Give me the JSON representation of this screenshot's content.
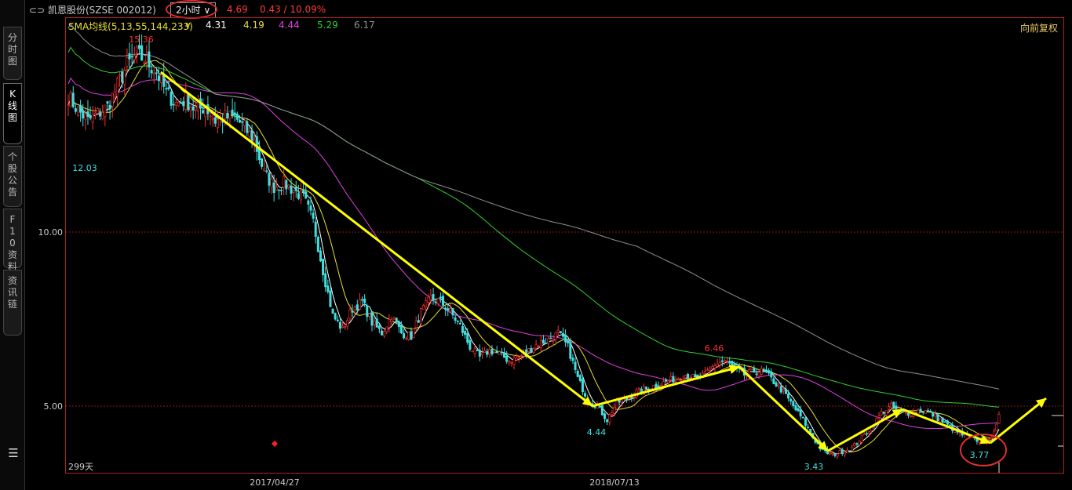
{
  "sidebar": {
    "tabs": [
      {
        "label": "分时图",
        "active": false
      },
      {
        "label": "K线图",
        "active": true
      },
      {
        "label": "个股公告",
        "active": false
      },
      {
        "label": "F10资料",
        "active": false
      },
      {
        "label": "资讯链",
        "active": false
      }
    ],
    "menu_icon": "menu-icon"
  },
  "header": {
    "stock": "凯恩股份(SZSE 002012)",
    "period": "2小时",
    "price": "4.69",
    "change": "0.43 / 10.09%"
  },
  "sma": {
    "label": "SMA均线(5,13,55,144,233)",
    "values": [
      {
        "value": "4.31",
        "color": "#ffffff"
      },
      {
        "value": "4.19",
        "color": "#e8e030"
      },
      {
        "value": "4.44",
        "color": "#e040e0"
      },
      {
        "value": "5.29",
        "color": "#30d030"
      },
      {
        "value": "6.17",
        "color": "#909090"
      }
    ]
  },
  "fq_label": "向前复权",
  "colors": {
    "up": "#ff3030",
    "down": "#40e0e0",
    "frame": "#b02020",
    "arrow": "#ffff00",
    "circle": "#e03030"
  },
  "chart_data": {
    "type": "candlestick",
    "y_ticks": [
      "10.00",
      "5.00"
    ],
    "x_ticks": [
      "2017/04/27",
      "2018/07/13"
    ],
    "annotations": {
      "high": "15.36",
      "left_low": "12.03",
      "low_1": "4.44",
      "peak_2": "6.46",
      "low_2": "3.43",
      "low_3": "3.77"
    },
    "days_label": "299天",
    "ylim": [
      3.2,
      16.5
    ],
    "close_path": [
      [
        0,
        13.9
      ],
      [
        4,
        13.5
      ],
      [
        8,
        13.2
      ],
      [
        12,
        13.4
      ],
      [
        16,
        13.6
      ],
      [
        20,
        14.2
      ],
      [
        24,
        14.8
      ],
      [
        28,
        15.1
      ],
      [
        32,
        14.9
      ],
      [
        36,
        14.6
      ],
      [
        40,
        14.0
      ],
      [
        44,
        13.7
      ],
      [
        48,
        13.8
      ],
      [
        52,
        13.5
      ],
      [
        56,
        13.6
      ],
      [
        60,
        13.2
      ],
      [
        64,
        13.3
      ],
      [
        68,
        13.3
      ],
      [
        72,
        13.0
      ],
      [
        76,
        12.6
      ],
      [
        80,
        11.7
      ],
      [
        84,
        11.3
      ],
      [
        88,
        11.4
      ],
      [
        92,
        11.2
      ],
      [
        96,
        11.0
      ],
      [
        100,
        10.3
      ],
      [
        104,
        8.9
      ],
      [
        108,
        7.6
      ],
      [
        112,
        7.2
      ],
      [
        116,
        7.8
      ],
      [
        120,
        8.0
      ],
      [
        124,
        7.4
      ],
      [
        128,
        7.1
      ],
      [
        132,
        7.6
      ],
      [
        136,
        7.1
      ],
      [
        140,
        7.0
      ],
      [
        144,
        7.7
      ],
      [
        148,
        8.1
      ],
      [
        152,
        8.0
      ],
      [
        156,
        7.7
      ],
      [
        160,
        7.3
      ],
      [
        164,
        6.7
      ],
      [
        168,
        6.4
      ],
      [
        172,
        6.6
      ],
      [
        176,
        6.5
      ],
      [
        180,
        6.3
      ],
      [
        184,
        6.4
      ],
      [
        188,
        6.6
      ],
      [
        192,
        6.8
      ],
      [
        196,
        6.9
      ],
      [
        200,
        7.1
      ],
      [
        204,
        6.7
      ],
      [
        208,
        5.8
      ],
      [
        212,
        5.2
      ],
      [
        216,
        5.0
      ],
      [
        220,
        4.6
      ],
      [
        224,
        5.1
      ],
      [
        228,
        5.2
      ],
      [
        232,
        5.4
      ],
      [
        236,
        5.5
      ],
      [
        240,
        5.6
      ],
      [
        244,
        5.7
      ],
      [
        248,
        5.8
      ],
      [
        252,
        5.9
      ],
      [
        256,
        5.8
      ],
      [
        260,
        5.9
      ],
      [
        264,
        6.2
      ],
      [
        268,
        6.3
      ],
      [
        272,
        6.1
      ],
      [
        276,
        5.9
      ],
      [
        280,
        6.0
      ],
      [
        284,
        6.0
      ],
      [
        288,
        5.7
      ],
      [
        292,
        5.4
      ],
      [
        296,
        5.0
      ],
      [
        300,
        4.6
      ],
      [
        304,
        4.1
      ],
      [
        308,
        3.7
      ],
      [
        312,
        3.6
      ],
      [
        316,
        3.7
      ],
      [
        320,
        3.8
      ],
      [
        324,
        4.1
      ],
      [
        328,
        4.4
      ],
      [
        332,
        4.8
      ],
      [
        336,
        5.0
      ],
      [
        340,
        4.8
      ],
      [
        344,
        4.8
      ],
      [
        348,
        4.9
      ],
      [
        352,
        4.8
      ],
      [
        356,
        4.6
      ],
      [
        360,
        4.4
      ],
      [
        364,
        4.2
      ],
      [
        368,
        4.1
      ],
      [
        372,
        4.0
      ],
      [
        376,
        4.0
      ],
      [
        380,
        4.69
      ]
    ]
  }
}
